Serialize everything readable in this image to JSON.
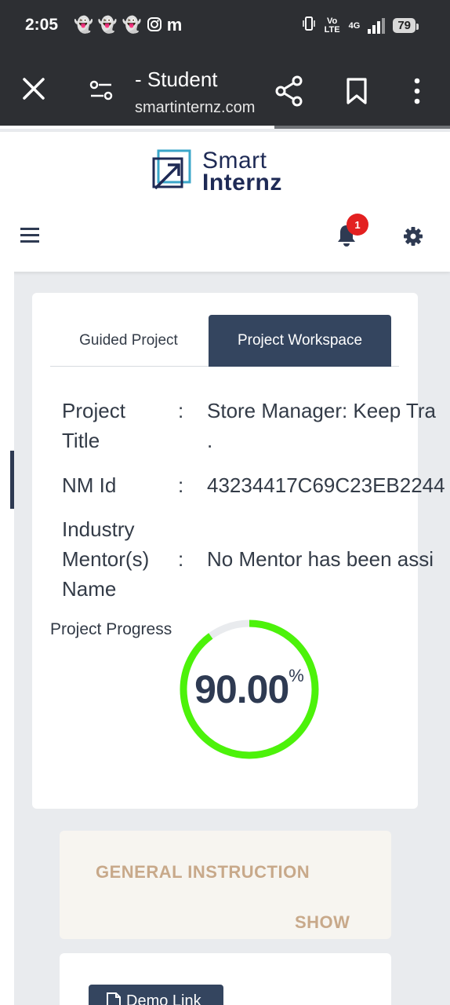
{
  "status_bar": {
    "time": "2:05",
    "notification_icons": [
      "snapchat-icon",
      "snapchat-icon",
      "snapchat-icon",
      "instagram-icon",
      "m-icon"
    ],
    "network": "Vo LTE",
    "network_type": "4G",
    "battery": "79"
  },
  "browser": {
    "page_title": "- Student",
    "url": "smartinternz.com",
    "load_progress": 0.61
  },
  "brand": {
    "name_line1": "Smart",
    "name_line2": "Internz"
  },
  "header": {
    "notification_count": "1"
  },
  "tabs": {
    "guided": "Guided Project",
    "workspace": "Project Workspace",
    "active": "Project Workspace"
  },
  "project": {
    "title_label_line1": "Project",
    "title_label_line2": "Title",
    "title_value_line1": "Store Manager: Keep Tra",
    "title_value_line2": ".",
    "nm_label": "NM Id",
    "nm_value": "43234417C69C23EB2244",
    "mentor_label_line1": "Industry",
    "mentor_label_line2": "Mentor(s)",
    "mentor_label_line3": "Name",
    "mentor_value": "No Mentor has been assi",
    "colon": ":"
  },
  "progress": {
    "label": "Project Progress",
    "value_text": "90.00",
    "unit": "%",
    "value": 0.9,
    "color": "#4cf20a",
    "track_color": "#e9ebee"
  },
  "instruction": {
    "heading": "GENERAL INSTRUCTION",
    "toggle": "SHOW"
  },
  "demo": {
    "button": "Demo Link"
  },
  "colors": {
    "primary": "#34455f",
    "accent_text": "#c8a98a",
    "badge": "#e32020"
  }
}
